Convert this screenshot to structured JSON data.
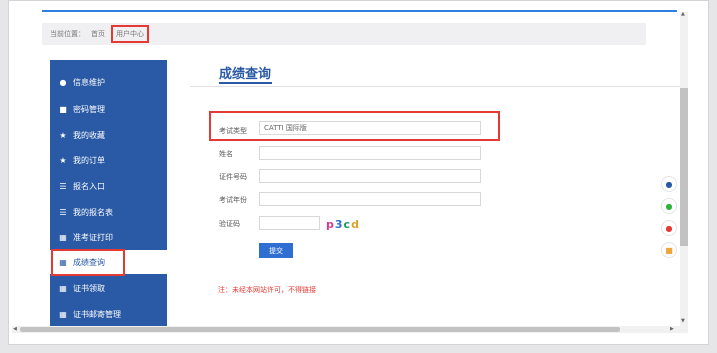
{
  "breadcrumb": {
    "prefix": "当前位置：",
    "home": "首页",
    "current": "用户中心"
  },
  "sidebar": {
    "items": [
      {
        "label": "信息维护",
        "icon": "user-icon"
      },
      {
        "label": "密码管理",
        "icon": "lock-icon"
      },
      {
        "label": "我的收藏",
        "icon": "star-icon"
      },
      {
        "label": "我的订单",
        "icon": "star-icon"
      },
      {
        "label": "报名入口",
        "icon": "list-icon"
      },
      {
        "label": "我的报名表",
        "icon": "list-icon"
      },
      {
        "label": "准考证打印",
        "icon": "grid-icon"
      },
      {
        "label": "成绩查询",
        "icon": "grid-icon"
      },
      {
        "label": "证书领取",
        "icon": "grid-icon"
      },
      {
        "label": "证书邮寄管理",
        "icon": "grid-icon"
      }
    ],
    "active_index": 7
  },
  "main": {
    "title": "成绩查询",
    "form": {
      "exam_type_label": "考试类型",
      "exam_type_value": "CATTI 国际版",
      "name_label": "姓名",
      "name_value": "",
      "id_label": "证件号码",
      "id_value": "",
      "year_label": "考试年份",
      "year_value": "",
      "captcha_label": "验证码",
      "captcha_value": "",
      "captcha_chars": [
        "p",
        "3",
        "c",
        "d"
      ],
      "submit_label": "提交"
    },
    "notice": "注：未经本网站许可，不得链接"
  },
  "float_buttons": [
    "qq-icon",
    "wechat-icon",
    "weibo-icon",
    "message-icon"
  ],
  "colors": {
    "accent": "#2a5aa6",
    "highlight": "#e53935",
    "button": "#2f6fd1"
  }
}
